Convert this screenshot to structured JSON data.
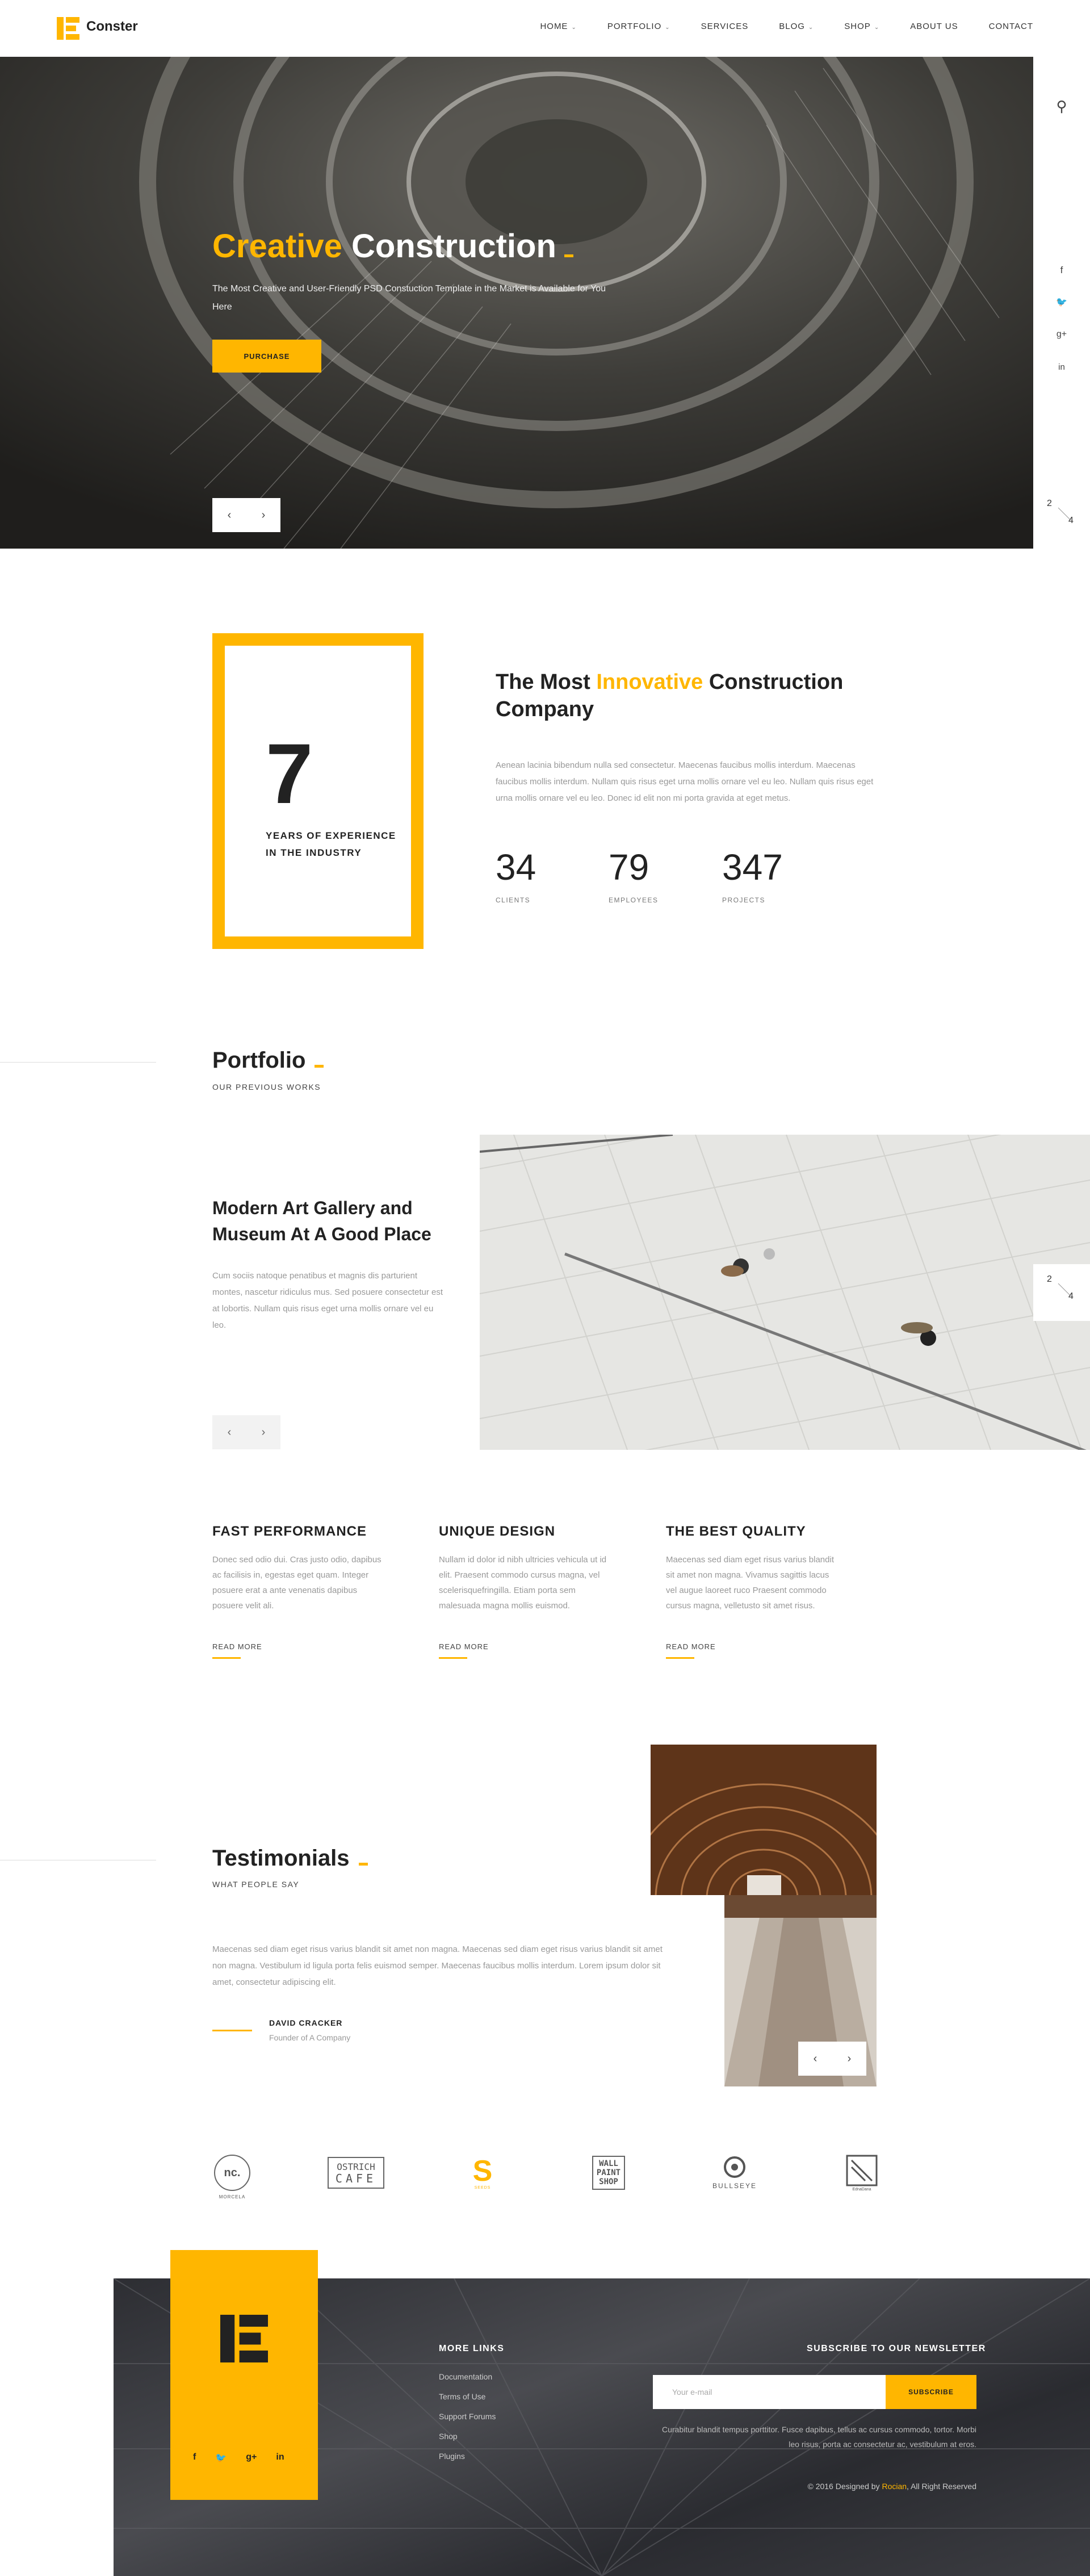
{
  "header": {
    "logo_text": "Conster",
    "nav": [
      {
        "label": "HOME",
        "dropdown": true
      },
      {
        "label": "PORTFOLIO",
        "dropdown": true
      },
      {
        "label": "SERVICES",
        "dropdown": false
      },
      {
        "label": "BLOG",
        "dropdown": true
      },
      {
        "label": "SHOP",
        "dropdown": true
      },
      {
        "label": "ABOUT US",
        "dropdown": false
      },
      {
        "label": "CONTACT",
        "dropdown": false
      }
    ]
  },
  "hero": {
    "title_accent": "Creative",
    "title_rest": "Construction",
    "subtitle": "The Most Creative and User-Friendly PSD Constuction Template in the Market is Available for You Here",
    "button": "PURCHASE",
    "prev": "‹",
    "next": "›"
  },
  "side_rail": {
    "icons": [
      "search-icon",
      "facebook-icon",
      "twitter-icon",
      "google-plus-icon",
      "linkedin-icon"
    ],
    "glyphs": {
      "search": "⚲",
      "facebook": "f",
      "twitter": "🐦",
      "google_plus": "g+",
      "linkedin": "in"
    },
    "pager_current": "2",
    "pager_total": "4"
  },
  "about": {
    "years": "7",
    "years_label_1": "YEARS OF EXPERIENCE",
    "years_label_2": "IN THE INDUSTRY",
    "heading_pre": "The Most",
    "heading_accent": "Innovative",
    "heading_post": "Construction Company",
    "text": "Aenean lacinia bibendum nulla sed consectetur. Maecenas faucibus mollis interdum. Maecenas faucibus mollis interdum. Nullam quis risus eget urna mollis ornare vel eu leo. Nullam quis risus eget urna mollis ornare vel eu leo. Donec id elit non mi porta gravida at eget metus.",
    "stats": [
      {
        "value": "34",
        "label": "CLIENTS"
      },
      {
        "value": "79",
        "label": "EMPLOYEES"
      },
      {
        "value": "347",
        "label": "PROJECTS"
      }
    ]
  },
  "portfolio": {
    "title": "Portfolio",
    "subtitle": "OUR PREVIOUS WORKS",
    "project_title": "Modern Art Gallery and Museum At A Good Place",
    "project_text": "Cum sociis natoque penatibus et magnis dis parturient montes, nascetur ridiculus mus. Sed posuere consectetur est at lobortis. Nullam quis risus eget urna mollis ornare vel eu leo.",
    "pager_current": "2",
    "pager_total": "4",
    "prev": "‹",
    "next": "›"
  },
  "features": [
    {
      "title": "FAST PERFORMANCE",
      "text": "Donec sed odio dui. Cras justo odio, dapibus ac facilisis in, egestas eget quam. Integer posuere erat a ante venenatis dapibus posuere velit ali.",
      "link": "READ MORE"
    },
    {
      "title": "UNIQUE DESIGN",
      "text": "Nullam id dolor id nibh ultricies vehicula ut id elit. Praesent commodo cursus magna, vel scelerisquefringilla. Etiam porta sem malesuada magna mollis euismod.",
      "link": "READ MORE"
    },
    {
      "title": "THE BEST QUALITY",
      "text": "Maecenas sed diam eget risus varius blandit sit amet non magna. Vivamus sagittis lacus vel augue laoreet ruco Praesent commodo cursus magna, velletusto sit amet risus.",
      "link": "READ MORE"
    }
  ],
  "testimonials": {
    "title": "Testimonials",
    "subtitle": "WHAT PEOPLE SAY",
    "quote": "Maecenas sed diam eget risus varius blandit sit amet non magna. Maecenas sed diam eget risus varius blandit sit amet non magna. Vestibulum id ligula porta felis euismod semper. Maecenas faucibus mollis interdum. Lorem ipsum dolor sit amet, consectetur adipiscing elit.",
    "author": "DAVID CRACKER",
    "role": "Founder of A Company",
    "prev": "‹",
    "next": "›"
  },
  "clients": {
    "nc": "nc.",
    "nc_sub": "MORCELA",
    "ostrich_1": "OSTRICH",
    "ostrich_2": "CAFE",
    "s_logo": "S",
    "s_sub": "SEEDS",
    "wall_1": "WALL",
    "wall_2": "PAINT",
    "wall_3": "SHOP",
    "bullseye": "BULLSEYE",
    "edna": "EdnaDana"
  },
  "footer": {
    "social": [
      "f",
      "🐦",
      "g+",
      "in"
    ],
    "links_title": "MORE LINKS",
    "links": [
      "Documentation",
      "Terms of Use",
      "Support Forums",
      "Shop",
      "Plugins"
    ],
    "newsletter_title": "SUBSCRIBE TO OUR NEWSLETTER",
    "email_placeholder": "Your e-mail",
    "subscribe": "SUBSCRIBE",
    "newsletter_text": "Curabitur blandit tempus porttitor. Fusce dapibus, tellus ac cursus commodo, tortor. Morbi leo risus, porta ac consectetur ac, vestibulum at eros.",
    "copyright_pre": "© 2016 Designed by",
    "copyright_brand": "Rocian",
    "copyright_post": ", All Right Reserved"
  },
  "colors": {
    "accent": "#ffb600",
    "dark": "#222222",
    "muted": "#999999"
  }
}
